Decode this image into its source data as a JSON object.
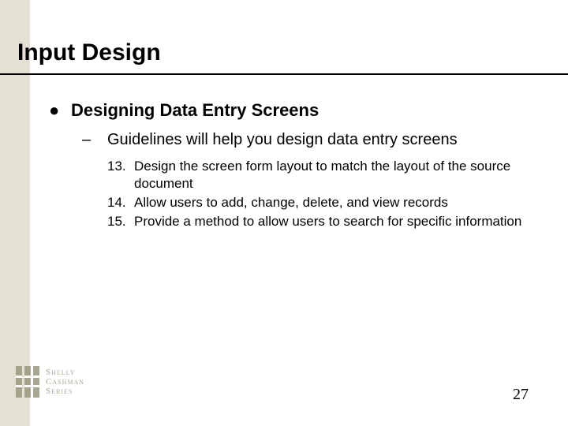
{
  "title": "Input Design",
  "bullet": {
    "marker": "●",
    "text": "Designing Data Entry Screens"
  },
  "sub": {
    "marker": "–",
    "text": "Guidelines will help you design data entry screens"
  },
  "items": [
    {
      "num": "13.",
      "text": "Design the screen form layout to match the layout of the source document"
    },
    {
      "num": "14.",
      "text": "Allow users to add, change, delete, and view records"
    },
    {
      "num": "15.",
      "text": "Provide a method to allow users to search for specific information"
    }
  ],
  "logo": {
    "line1": "Shelly",
    "line2": "Cashman",
    "line3": "Series"
  },
  "page_number": "27"
}
